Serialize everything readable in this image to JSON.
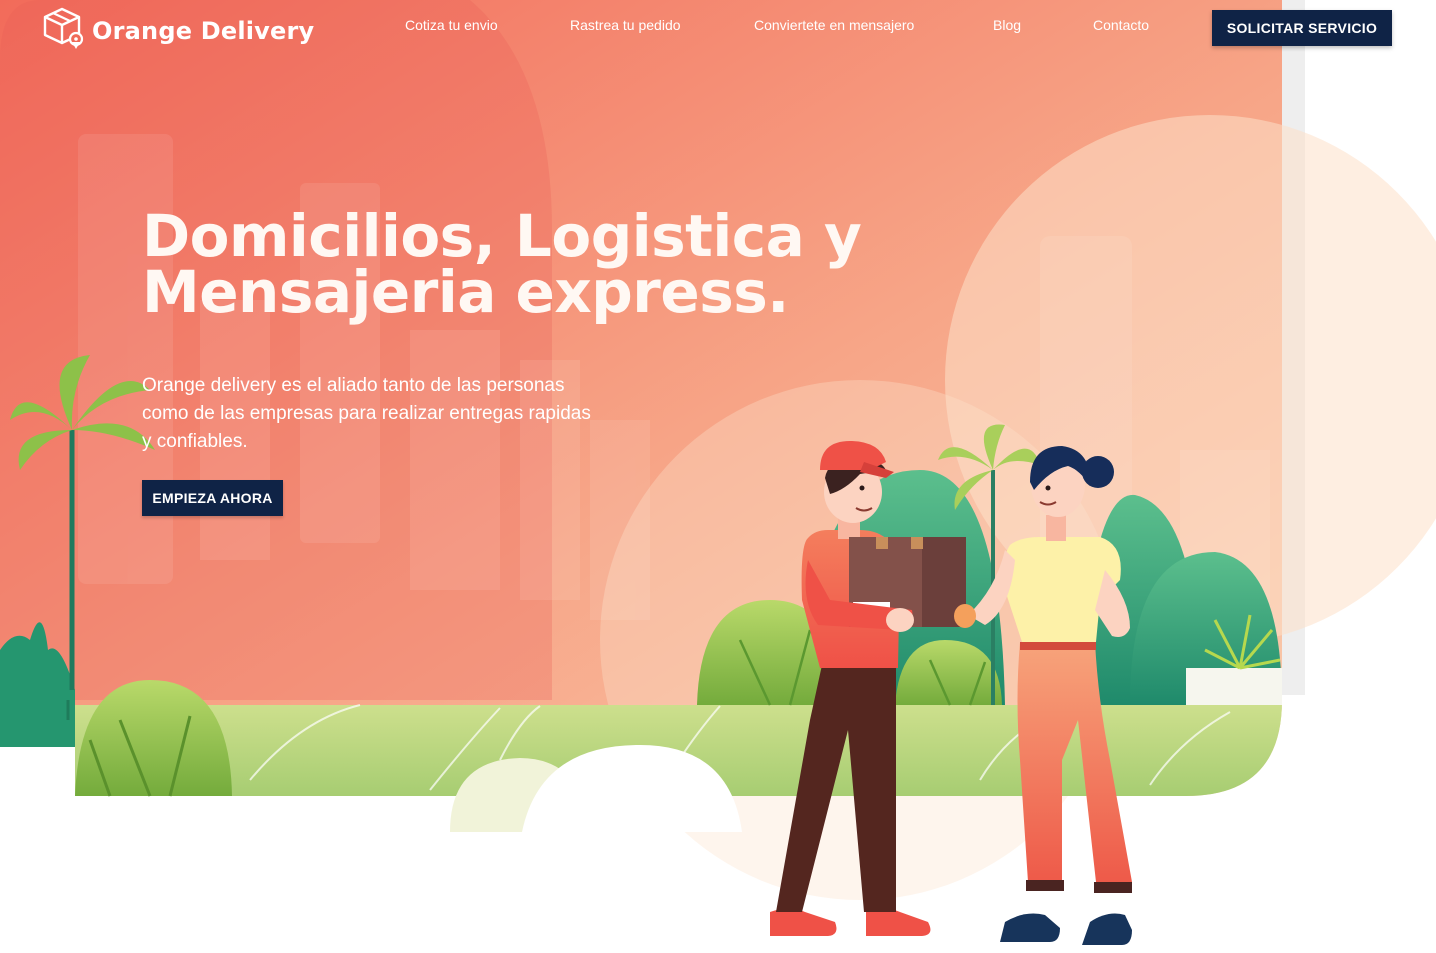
{
  "brand": {
    "name": "Orange Delivery",
    "logo_icon": "box-location-icon"
  },
  "nav": {
    "links": [
      "Cotiza tu envio",
      "Rastrea tu pedido",
      "Conviertete en mensajero",
      "Blog",
      "Contacto"
    ],
    "cta_label": "SOLICITAR SERVICIO"
  },
  "hero": {
    "title_line1": "Domicilios, Logistica y",
    "title_line2": "Mensajeria express.",
    "description": "Orange delivery es el aliado tanto de las personas como de las empresas para realizar entregas rapidas y confiables.",
    "button_label": "EMPIEZA AHORA"
  },
  "colors": {
    "navy": "#0f2346",
    "coral": "#f07563",
    "peach": "#f8c7a3",
    "grass": "#a9d072",
    "teal": "#2ea07f"
  }
}
